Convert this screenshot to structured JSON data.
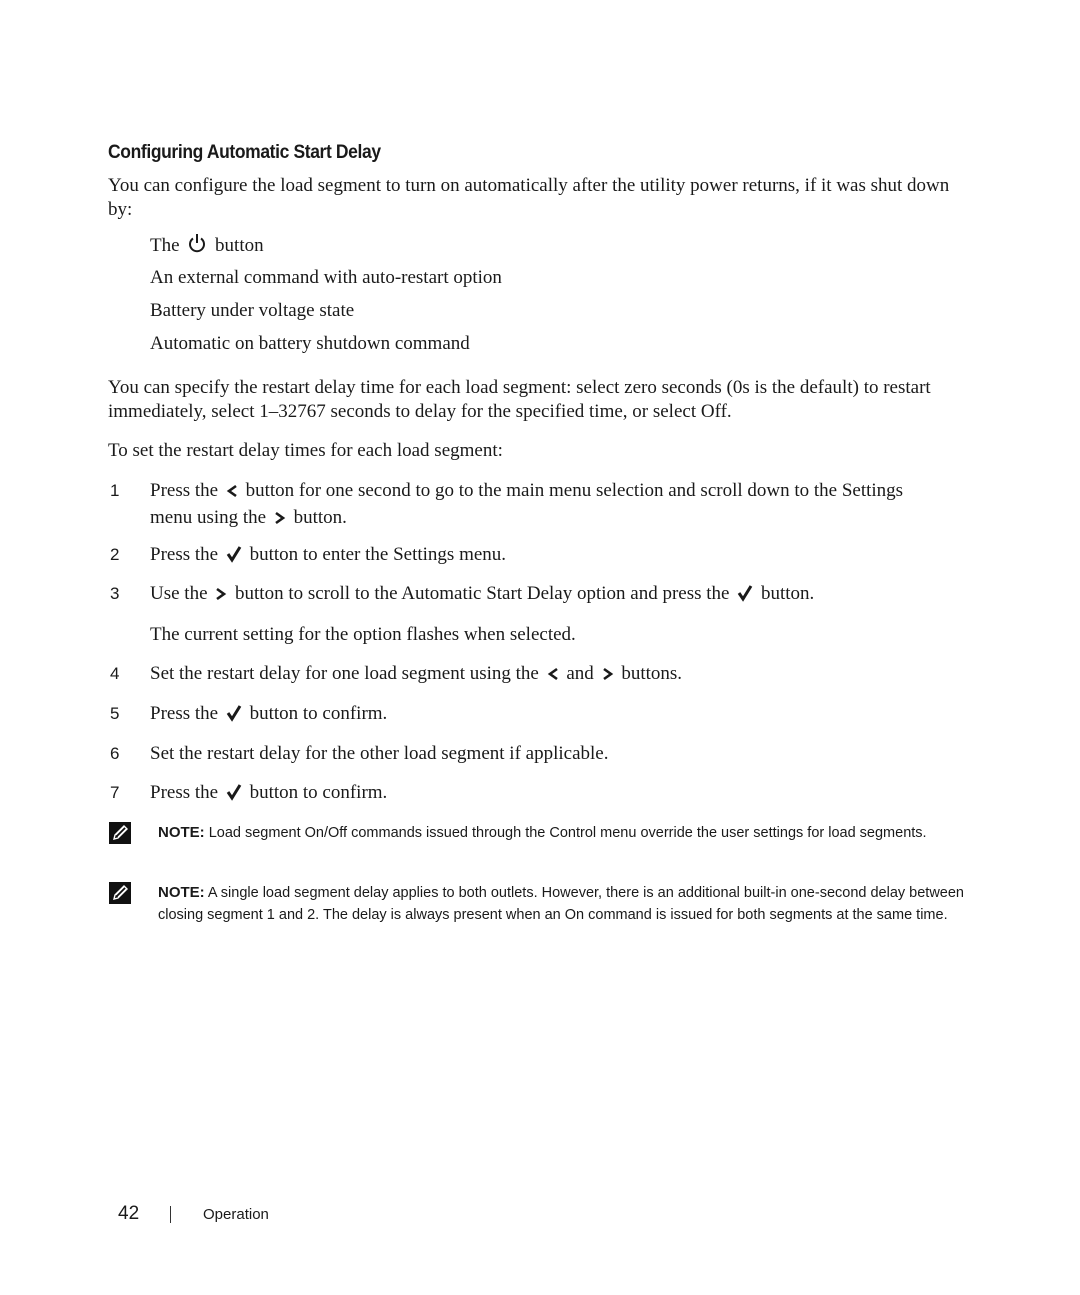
{
  "section": {
    "title": "Configuring Automatic Start Delay",
    "intro": "You can configure the load segment to turn on automatically after the utility power returns, if it was shut down by:",
    "bullets": {
      "b0_pre": "The",
      "b0_icon": "power-icon",
      "b0_post": "button",
      "b1": "An external command with auto-restart option",
      "b2": "Battery under voltage state",
      "b3": "Automatic on battery shutdown command"
    },
    "delay_para": "You can specify the restart delay time for each load segment: select zero seconds (0s is the default) to restart immediately, select 1–32767 seconds to delay for the specified time, or select Off.",
    "steps_intro": "To set the restart delay times for each load segment:"
  },
  "steps": {
    "s1": {
      "num": "1",
      "t1": "Press the",
      "icon1": "chevron-left-icon",
      "t2": "button for one second to go to the main menu selection and scroll down to the Settings menu using the",
      "icon2": "chevron-right-icon",
      "t3": "button."
    },
    "s2": {
      "num": "2",
      "t1": "Press the",
      "icon1": "checkmark-icon",
      "t2": "button to enter the Settings menu."
    },
    "s3": {
      "num": "3",
      "t1": "Use the",
      "icon1": "chevron-right-icon",
      "t2": "button to scroll to the Automatic Start Delay option and press the",
      "icon2": "checkmark-icon",
      "t3": "button.",
      "sub": "The current setting for the option flashes when selected."
    },
    "s4": {
      "num": "4",
      "t1": "Set the restart delay for one load segment using the",
      "icon1": "chevron-left-icon",
      "t2": "and",
      "icon2": "chevron-right-icon",
      "t3": "buttons."
    },
    "s5": {
      "num": "5",
      "t1": "Press the",
      "icon1": "checkmark-icon",
      "t2": "button to confirm."
    },
    "s6": {
      "num": "6",
      "t1": "Set the restart delay for the other load segment if applicable."
    },
    "s7": {
      "num": "7",
      "t1": "Press the",
      "icon1": "checkmark-icon",
      "t2": "button to confirm."
    }
  },
  "notes": [
    {
      "label": "NOTE:",
      "icon": "pencil-note-icon",
      "text": " Load segment On/Off commands issued through the Control menu override the user settings for load segments."
    },
    {
      "label": "NOTE:",
      "icon": "pencil-note-icon",
      "text": " A single load segment delay applies to both outlets. However, there is an additional built-in one-second delay between closing segment 1 and 2. The delay is always present when an On command is issued for both segments at the same time."
    }
  ],
  "footer": {
    "page_number": "42",
    "section_name": "Operation"
  }
}
